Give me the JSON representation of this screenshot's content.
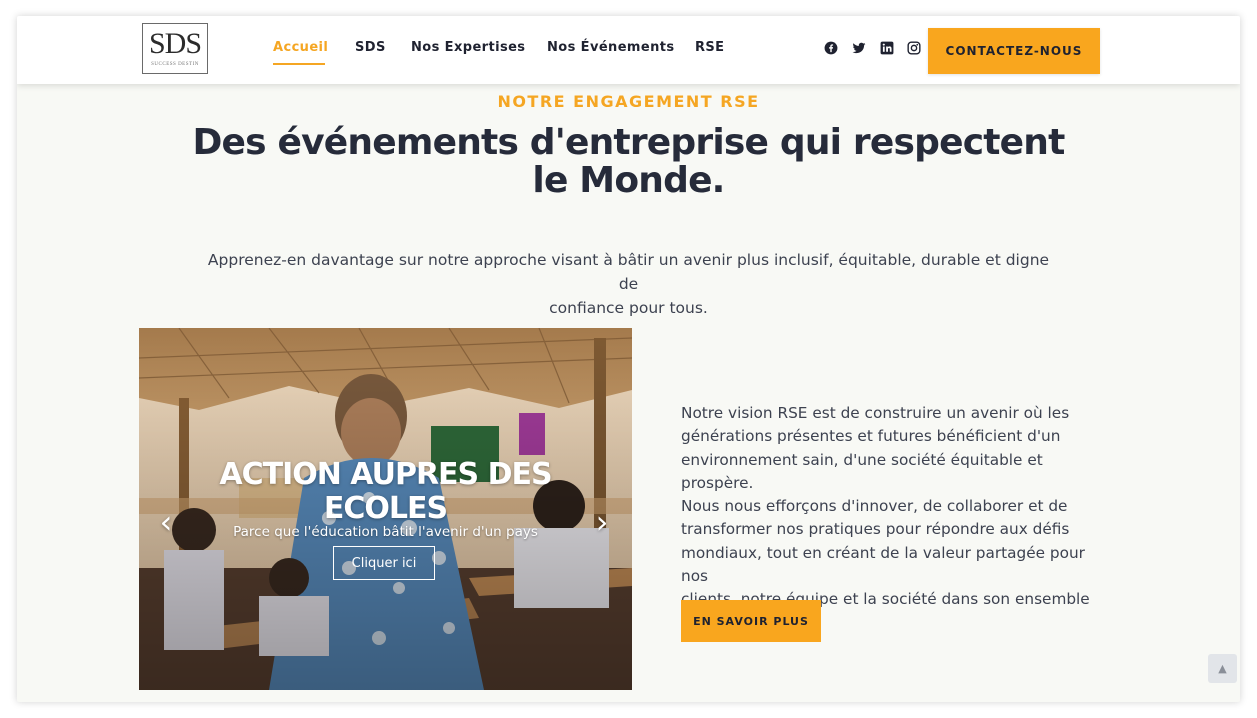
{
  "header": {
    "logo_text": "SDS",
    "logo_subtext": "SUCCESS DESTIN",
    "nav": [
      {
        "label": "Accueil",
        "active": true
      },
      {
        "label": "SDS",
        "active": false
      },
      {
        "label": "Nos Expertises",
        "active": false
      },
      {
        "label": "Nos Événements",
        "active": false
      },
      {
        "label": "RSE",
        "active": false
      }
    ],
    "social_icons": [
      "facebook-icon",
      "twitter-icon",
      "linkedin-icon",
      "instagram-icon"
    ],
    "contact_label": "CONTACTEZ-NOUS"
  },
  "hero": {
    "eyebrow": "NOTRE ENGAGEMENT RSE",
    "heading_line1": "Des événements d'entreprise qui respectent",
    "heading_line2": "le Monde.",
    "lead_line1": "Apprenez-en davantage sur notre approche visant à bâtir un avenir plus inclusif, équitable, durable et digne de",
    "lead_line2": "confiance pour tous."
  },
  "slider": {
    "title_line1": "ACTION AUPRES DES",
    "title_line2": "ECOLES",
    "subtitle": "Parce que l'éducation bâtit l'avenir d'un pays",
    "button_label": "Cliquer ici",
    "prev_icon": "chevron-left-icon",
    "next_icon": "chevron-right-icon"
  },
  "vision": {
    "lines": [
      "Notre vision RSE est de construire un avenir où les",
      "générations présentes et futures bénéficient d'un",
      "environnement sain, d'une société équitable et prospère.",
      "Nous nous efforçons d'innover, de collaborer et de",
      "transformer nos pratiques pour répondre aux défis",
      "mondiaux, tout en créant de la valeur partagée pour nos",
      "clients, notre équipe et la société dans son ensemble"
    ],
    "button_label": "EN SAVOIR PLUS"
  },
  "scroll_top_icon": "chevron-up-icon",
  "colors": {
    "accent": "#f9a61e",
    "heading": "#262b3a",
    "background": "#f8f9f5"
  }
}
